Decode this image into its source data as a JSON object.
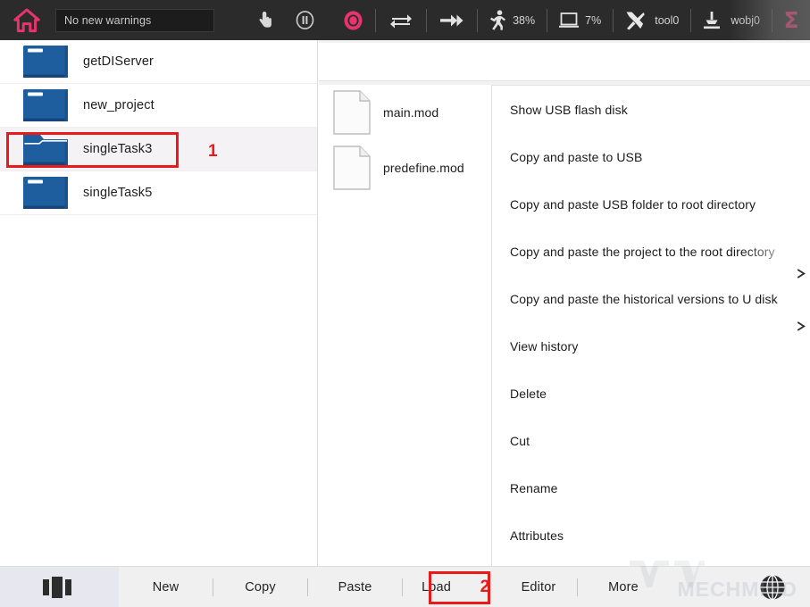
{
  "topbar": {
    "home_icon": "home-icon",
    "warning_text": "No new warnings",
    "jog_icon": "hand-pointer-icon",
    "pause_icon": "pause-circle-icon",
    "stop_icon": "stop-record-icon",
    "loop_icon": "loop-cycle-icon",
    "step_icon": "step-forward-icon",
    "speed_icon": "running-man-icon",
    "speed_value": "38%",
    "screen_icon": "monitor-icon",
    "screen_value": "7%",
    "tool_icon": "tools-icon",
    "tool_value": "tool0",
    "wobj_icon": "work-object-icon",
    "wobj_value": "wobj0",
    "sigma_icon": "sigma-icon",
    "accent_pink": "#e8346e",
    "bar_background": "#2b2b2b"
  },
  "sidebar": {
    "folders": [
      {
        "label": "getDIServer",
        "state": "closed",
        "selected": false
      },
      {
        "label": "new_project",
        "state": "closed",
        "selected": false
      },
      {
        "label": "singleTask3",
        "state": "open",
        "selected": true
      },
      {
        "label": "singleTask5",
        "state": "closed",
        "selected": false
      }
    ],
    "folder_color": "#1f5e9e",
    "selected_row_background": "#f4f2f4"
  },
  "files": {
    "items": [
      {
        "label": "main.mod",
        "icon": "file-icon"
      },
      {
        "label": "predefine.mod",
        "icon": "file-icon"
      }
    ]
  },
  "context_menu": {
    "items": [
      {
        "label": "Show USB flash disk",
        "clipped": false
      },
      {
        "label": "Copy and paste to USB",
        "clipped": false
      },
      {
        "label": "Copy and paste USB folder to root directory",
        "clipped": false
      },
      {
        "label": "Copy and paste the project to the root directory",
        "clipped": true
      },
      {
        "label": "Copy and paste the historical versions to U disk",
        "clipped": false
      },
      {
        "label": "View history",
        "clipped": false
      },
      {
        "label": "Delete",
        "clipped": false
      },
      {
        "label": "Cut",
        "clipped": false
      },
      {
        "label": "Rename",
        "clipped": false
      },
      {
        "label": "Attributes",
        "clipped": false
      }
    ],
    "scroll_hint_icon": "chevron-right-icon"
  },
  "bottombar": {
    "grid_icon": "panel-layout-icon",
    "buttons": [
      {
        "label": "New",
        "highlighted": false
      },
      {
        "label": "Copy",
        "highlighted": false
      },
      {
        "label": "Paste",
        "highlighted": false
      },
      {
        "label": "Load",
        "highlighted": true
      },
      {
        "label": "Editor",
        "highlighted": false
      },
      {
        "label": "More",
        "highlighted": false
      }
    ],
    "globe_icon": "globe-language-icon"
  },
  "annotations": {
    "marker_1": "1",
    "marker_2": "2",
    "box_color": "#e81b1b"
  },
  "watermark": {
    "text": "MECHMIND"
  }
}
